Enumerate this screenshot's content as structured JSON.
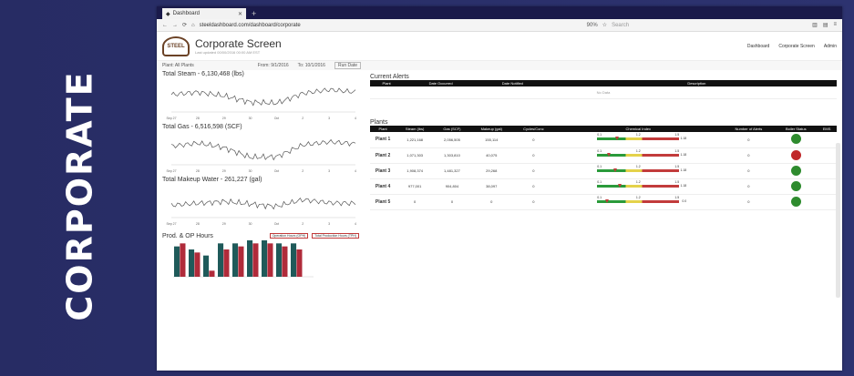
{
  "side_label": "CORPORATE",
  "browser": {
    "tab_title": "Dashboard",
    "url": "steeldashboard.com/dashboard/corporate",
    "zoom": "90%",
    "search_placeholder": "Search"
  },
  "app": {
    "title": "Corporate Screen",
    "subtitle": "Last updated 00/00/2016 00:00 AM EST",
    "logo_text": "STEEL",
    "nav": [
      "Dashboard",
      "Corporate Screen",
      "Admin"
    ]
  },
  "filters": {
    "plant": "Plant: All Plants",
    "from": "From: 9/1/2016",
    "to": "To: 10/1/2016",
    "go": "Run Date"
  },
  "charts": {
    "steam_title": "Total Steam - 6,130,468 (lbs)",
    "gas_title": "Total Gas - 6,516,598 (SCF)",
    "water_title": "Total Makeup Water - 261,227 (gal)",
    "prod_title": "Prod. & OP Hours",
    "prod_legend": [
      "Operation Hours (OPH)",
      "Total Production Hours (TPH)"
    ],
    "x_ticks": [
      "Sep 27",
      "28",
      "29",
      "30",
      "Oct",
      "2",
      "3",
      "4"
    ]
  },
  "chart_data": [
    {
      "type": "line",
      "title": "Total Steam - 6,130,468 (lbs)",
      "x": [
        "Sep 27",
        "28",
        "29",
        "30",
        "Oct",
        "2",
        "3",
        "4"
      ],
      "series": [
        {
          "values": [
            4.8,
            5.2,
            4.6,
            3.6,
            3.4,
            5.0,
            5.6,
            5.2
          ]
        }
      ]
    },
    {
      "type": "line",
      "title": "Total Gas - 6,516,598 (SCF)",
      "x": [
        "Sep 27",
        "28",
        "29",
        "30",
        "Oct",
        "2",
        "3",
        "4"
      ],
      "series": [
        {
          "values": [
            5.0,
            5.5,
            4.8,
            3.2,
            3.3,
            5.2,
            5.7,
            5.4
          ]
        }
      ]
    },
    {
      "type": "line",
      "title": "Total Makeup Water - 261,227 (gal)",
      "x": [
        "Sep 27",
        "28",
        "29",
        "30",
        "Oct",
        "2",
        "3",
        "4"
      ],
      "series": [
        {
          "values": [
            4.0,
            4.3,
            4.6,
            4.2,
            3.8,
            4.9,
            4.4,
            4.3
          ]
        }
      ]
    },
    {
      "type": "bar",
      "title": "Prod. & OP Hours",
      "categories": [
        "1",
        "2",
        "3",
        "4",
        "5",
        "6",
        "7",
        "8",
        "9"
      ],
      "series": [
        {
          "name": "Operation Hours (OPH)",
          "values": [
            20,
            18,
            14,
            22,
            22,
            24,
            24,
            22,
            22
          ]
        },
        {
          "name": "Total Production Hours (TPH)",
          "values": [
            22,
            16,
            4,
            18,
            20,
            22,
            22,
            20,
            18
          ]
        }
      ],
      "ylim": [
        0,
        24
      ]
    }
  ],
  "alerts": {
    "title": "Current Alerts",
    "columns": [
      "Plant",
      "Date Occurred",
      "Date Notified",
      "",
      "Description"
    ],
    "empty_text": "No Data"
  },
  "plants": {
    "title": "Plants",
    "columns": [
      "Plant",
      "Steam (lbs)",
      "Gas (SCF)",
      "Makeup (gal)",
      "Cycles/Conc",
      "Chemical Index",
      "Number of Alerts",
      "Boiler Status",
      "EMS"
    ],
    "rows": [
      {
        "name": "Plant 1",
        "steam": "1,221,168",
        "gas": "2,056,505",
        "makeup": "155,114",
        "cycles": "0",
        "alerts": "0",
        "status": "#2e8b2e",
        "pointer": 0.22,
        "gauge_val": "1.18"
      },
      {
        "name": "Plant 2",
        "steam": "1,071,303",
        "gas": "1,303,810",
        "makeup": "40,075",
        "cycles": "0",
        "alerts": "0",
        "status": "#c0282a",
        "pointer": 0.12,
        "gauge_val": "1.18"
      },
      {
        "name": "Plant 3",
        "steam": "1,908,374",
        "gas": "1,481,327",
        "makeup": "29,268",
        "cycles": "0",
        "alerts": "0",
        "status": "#2e8b2e",
        "pointer": 0.2,
        "gauge_val": "1.18"
      },
      {
        "name": "Plant 4",
        "steam": "977,001",
        "gas": "904,804",
        "makeup": "38,097",
        "cycles": "0",
        "alerts": "0",
        "status": "#2e8b2e",
        "pointer": 0.25,
        "gauge_val": "1.18"
      },
      {
        "name": "Plant 5",
        "steam": "0",
        "gas": "0",
        "makeup": "0",
        "cycles": "0",
        "alerts": "0",
        "status": "#2e8b2e",
        "pointer": 0.1,
        "gauge_val": "0.0"
      }
    ],
    "gauge_ticks": [
      "0.1",
      "1.2",
      "1.5"
    ]
  }
}
